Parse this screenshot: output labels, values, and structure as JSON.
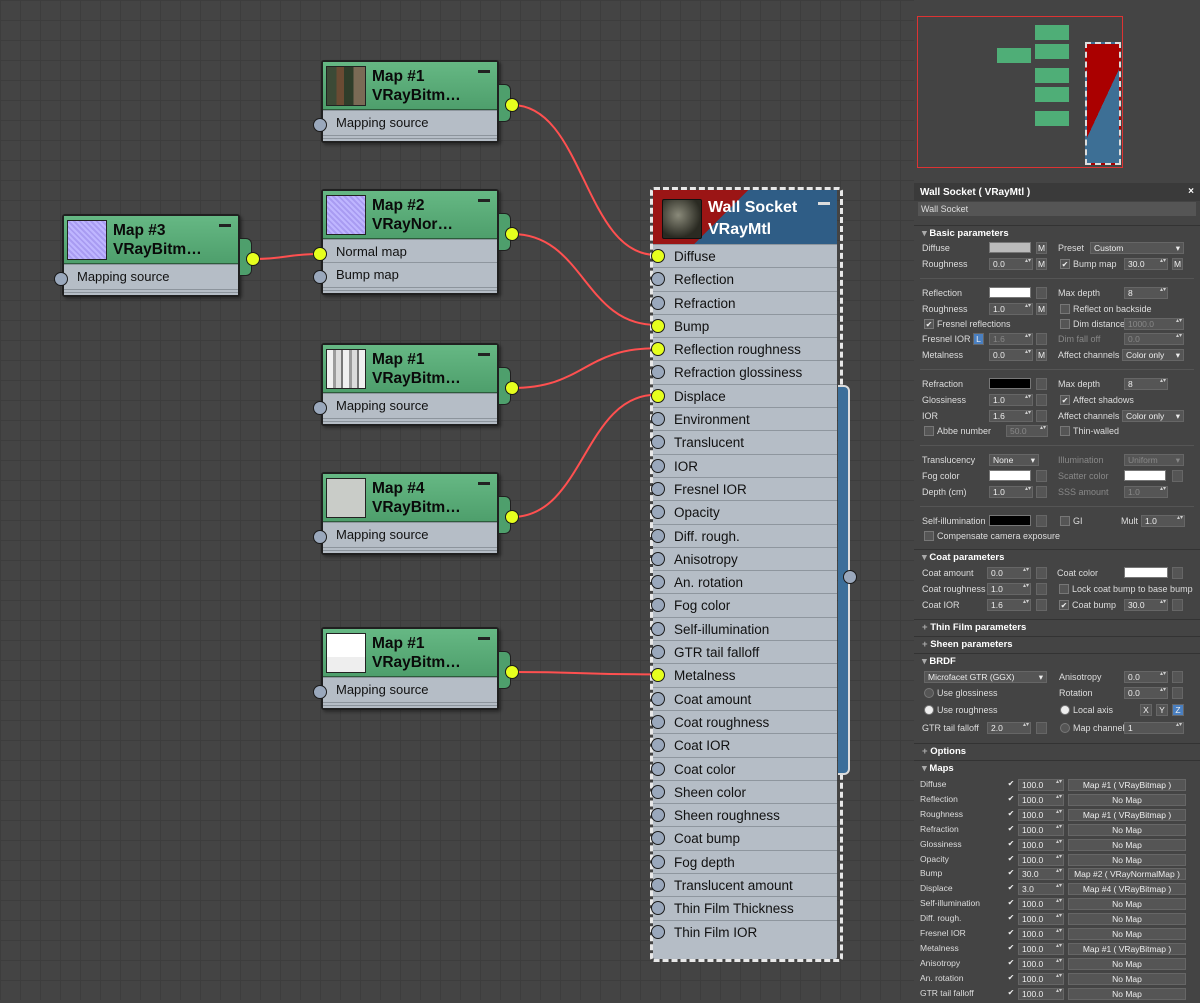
{
  "nodes": [
    {
      "title": "Map #1",
      "sub": "VRayBitm…",
      "slots": [
        "Mapping source"
      ],
      "thumb": "checker"
    },
    {
      "title": "Map #2",
      "sub": "VRayNor…",
      "slots": [
        "Normal map",
        "Bump map"
      ],
      "thumb": "normal"
    },
    {
      "title": "Map #3",
      "sub": "VRayBitm…",
      "slots": [
        "Mapping source"
      ],
      "thumb": "normal"
    },
    {
      "title": "Map #1",
      "sub": "VRayBitm…",
      "slots": [
        "Mapping source"
      ],
      "thumb": "gray"
    },
    {
      "title": "Map #4",
      "sub": "VRayBitm…",
      "slots": [
        "Mapping source"
      ],
      "thumb": "light"
    },
    {
      "title": "Map #1",
      "sub": "VRayBitm…",
      "slots": [
        "Mapping source"
      ],
      "thumb": "white"
    }
  ],
  "material": {
    "title": "Wall Socket",
    "sub": "VRayMtl",
    "slots": [
      "Diffuse",
      "Reflection",
      "Refraction",
      "Bump",
      "Reflection roughness",
      "Refraction glossiness",
      "Displace",
      "Environment",
      "Translucent",
      "IOR",
      "Fresnel IOR",
      "Opacity",
      "Diff. rough.",
      "Anisotropy",
      "An. rotation",
      "Fog color",
      "Self-illumination",
      "GTR tail falloff",
      "Metalness",
      "Coat amount",
      "Coat roughness",
      "Coat IOR",
      "Coat color",
      "Sheen color",
      "Sheen roughness",
      "Coat bump",
      "Fog depth",
      "Translucent amount",
      "Thin Film Thickness",
      "Thin Film IOR"
    ],
    "connected": [
      0,
      3,
      4,
      6,
      18
    ]
  },
  "panel": {
    "title": "Wall Socket  ( VRayMtl )",
    "name": "Wall Socket",
    "sections": {
      "basic": "Basic parameters",
      "coat": "Coat parameters",
      "thin": "Thin Film parameters",
      "sheen": "Sheen parameters",
      "brdf": "BRDF",
      "options": "Options",
      "maps": "Maps"
    },
    "basic": {
      "diffuse": "Diffuse",
      "m": "M",
      "preset": "Preset",
      "preset_val": "Custom",
      "roughness": "Roughness",
      "rough_val": "0.0",
      "bump_map": "Bump map",
      "bump_val": "30.0",
      "reflection": "Reflection",
      "max_depth": "Max depth",
      "depth_val": "8",
      "refl_rough": "Roughness",
      "refl_rough_val": "1.0",
      "reflect_backside": "Reflect on backside",
      "fresnel": "Fresnel reflections",
      "dim_distance": "Dim distance",
      "dim_val": "1000.0",
      "fresnel_ior": "Fresnel IOR",
      "l": "L",
      "fior_val": "1.6",
      "dim_falloff": "Dim fall off",
      "dfo_val": "0.0",
      "metalness": "Metalness",
      "metal_val": "0.0",
      "affect_channels": "Affect channels",
      "color_only": "Color only",
      "refraction": "Refraction",
      "rmax_depth": "Max depth",
      "rdepth_val": "8",
      "glossiness": "Glossiness",
      "gloss_val": "1.0",
      "affect_shadows": "Affect shadows",
      "ior": "IOR",
      "ior_val": "1.6",
      "raffect_channels": "Affect channels",
      "rcolor_only": "Color only",
      "abbe": "Abbe number",
      "abbe_val": "50.0",
      "thin_walled": "Thin-walled",
      "translucency": "Translucency",
      "trans_val": "None",
      "illumination": "Illumination",
      "illum_val": "Uniform",
      "fog_color": "Fog color",
      "scatter_color": "Scatter color",
      "depth": "Depth (cm)",
      "depth_cm_val": "1.0",
      "sss": "SSS amount",
      "sss_val": "1.0",
      "self_illum": "Self-illumination",
      "gi": "GI",
      "mult": "Mult",
      "mult_val": "1.0",
      "comp_cam": "Compensate camera exposure"
    },
    "coat": {
      "amount": "Coat amount",
      "amount_val": "0.0",
      "color": "Coat color",
      "rough": "Coat roughness",
      "rough_val": "1.0",
      "lock": "Lock coat bump to base bump",
      "ior": "Coat IOR",
      "ior_val": "1.6",
      "bump": "Coat bump",
      "bump_val": "30.0"
    },
    "brdf": {
      "type": "Microfacet GTR (GGX)",
      "aniso": "Anisotropy",
      "aniso_val": "0.0",
      "use_gloss": "Use glossiness",
      "rotation": "Rotation",
      "rot_val": "0.0",
      "use_rough": "Use roughness",
      "local_axis": "Local axis",
      "x": "X",
      "y": "Y",
      "z": "Z",
      "gtr": "GTR tail falloff",
      "gtr_val": "2.0",
      "map_channel": "Map channel",
      "mc_val": "1"
    },
    "maps": [
      {
        "n": "Diffuse",
        "v": "100.0",
        "m": "Map #1  ( VRayBitmap )"
      },
      {
        "n": "Reflection",
        "v": "100.0",
        "m": "No Map"
      },
      {
        "n": "Roughness",
        "v": "100.0",
        "m": "Map #1  ( VRayBitmap )"
      },
      {
        "n": "Refraction",
        "v": "100.0",
        "m": "No Map"
      },
      {
        "n": "Glossiness",
        "v": "100.0",
        "m": "No Map"
      },
      {
        "n": "Opacity",
        "v": "100.0",
        "m": "No Map"
      },
      {
        "n": "Bump",
        "v": "30.0",
        "m": "Map #2  ( VRayNormalMap )"
      },
      {
        "n": "Displace",
        "v": "3.0",
        "m": "Map #4  ( VRayBitmap )"
      },
      {
        "n": "Self-illumination",
        "v": "100.0",
        "m": "No Map"
      },
      {
        "n": "Diff. rough.",
        "v": "100.0",
        "m": "No Map"
      },
      {
        "n": "Fresnel IOR",
        "v": "100.0",
        "m": "No Map"
      },
      {
        "n": "Metalness",
        "v": "100.0",
        "m": "Map #1  ( VRayBitmap )"
      },
      {
        "n": "Anisotropy",
        "v": "100.0",
        "m": "No Map"
      },
      {
        "n": "An. rotation",
        "v": "100.0",
        "m": "No Map"
      },
      {
        "n": "GTR tail falloff",
        "v": "100.0",
        "m": "No Map"
      }
    ]
  }
}
